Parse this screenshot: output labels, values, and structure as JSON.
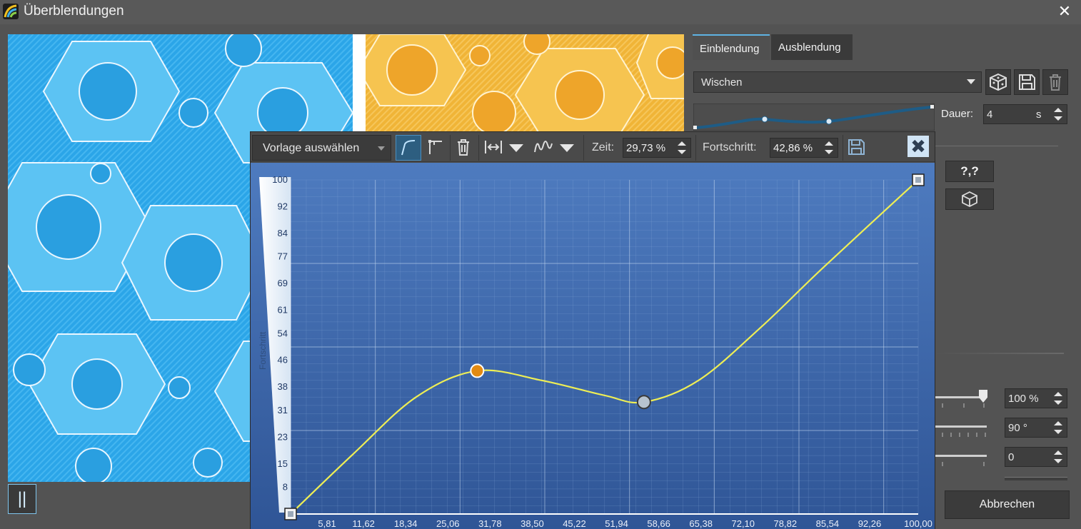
{
  "window": {
    "title": "Überblendungen",
    "close_glyph": "✕"
  },
  "preview": {
    "play_label": "||"
  },
  "tabs": [
    {
      "label": "Einblendung",
      "active": true
    },
    {
      "label": "Ausblendung",
      "active": false
    }
  ],
  "effect": {
    "selected": "Wischen"
  },
  "duration": {
    "label": "Dauer:",
    "value": "4",
    "unit": "s"
  },
  "help_button": {
    "label": "?,?"
  },
  "values": [
    {
      "value": "100 %"
    },
    {
      "value": "90 °"
    },
    {
      "value": "0"
    }
  ],
  "cancel_label": "Abbrechen",
  "editor": {
    "template_label": "Vorlage auswählen",
    "time_label": "Zeit:",
    "time_value": "29,73 %",
    "progress_label": "Fortschritt:",
    "progress_value": "42,86 %",
    "close_glyph": "✖"
  },
  "icons": [
    "app-logo-icon",
    "dice-icon",
    "save-icon",
    "trash-icon",
    "curve-edit-icon",
    "hold-icon",
    "width-arrows-icon",
    "wave-icon",
    "chevron-down-icon"
  ],
  "colors": {
    "accent": "#5fb3e4",
    "curve": "#f0f050",
    "plot_bg": "#3f66a8",
    "handle_orange": "#e38a12"
  },
  "chart_data": {
    "type": "line",
    "title": "",
    "xlabel": "",
    "ylabel": "Fortschritt",
    "xlim": [
      0,
      100
    ],
    "ylim": [
      0,
      100
    ],
    "x_ticks": [
      "5,81",
      "11,62",
      "18,34",
      "25,06",
      "31,78",
      "38,50",
      "45,22",
      "51,94",
      "58,66",
      "65,38",
      "72,10",
      "78,82",
      "85,54",
      "92,26",
      "100,00"
    ],
    "x_tick_values": [
      5.81,
      11.62,
      18.34,
      25.06,
      31.78,
      38.5,
      45.22,
      51.94,
      58.66,
      65.38,
      72.1,
      78.82,
      85.54,
      92.26,
      100.0
    ],
    "y_ticks": [
      "8",
      "15",
      "23",
      "31",
      "38",
      "46",
      "54",
      "61",
      "69",
      "77",
      "84",
      "92",
      "100"
    ],
    "y_tick_values": [
      8,
      15,
      23,
      31,
      38,
      46,
      54,
      61,
      69,
      77,
      84,
      92,
      100
    ],
    "grid": true,
    "series": [
      {
        "x": [
          0,
          10,
          20,
          29.73,
          40,
          50,
          56.3,
          65,
          75,
          85,
          100
        ],
        "y": [
          0,
          18,
          35,
          42.86,
          40,
          35.5,
          33.5,
          40,
          56,
          74,
          100
        ]
      }
    ],
    "control_points": [
      {
        "x": 0,
        "y": 0,
        "kind": "start"
      },
      {
        "x": 29.73,
        "y": 42.86,
        "kind": "selected"
      },
      {
        "x": 56.3,
        "y": 33.5,
        "kind": "point"
      },
      {
        "x": 100,
        "y": 100,
        "kind": "end"
      }
    ]
  }
}
